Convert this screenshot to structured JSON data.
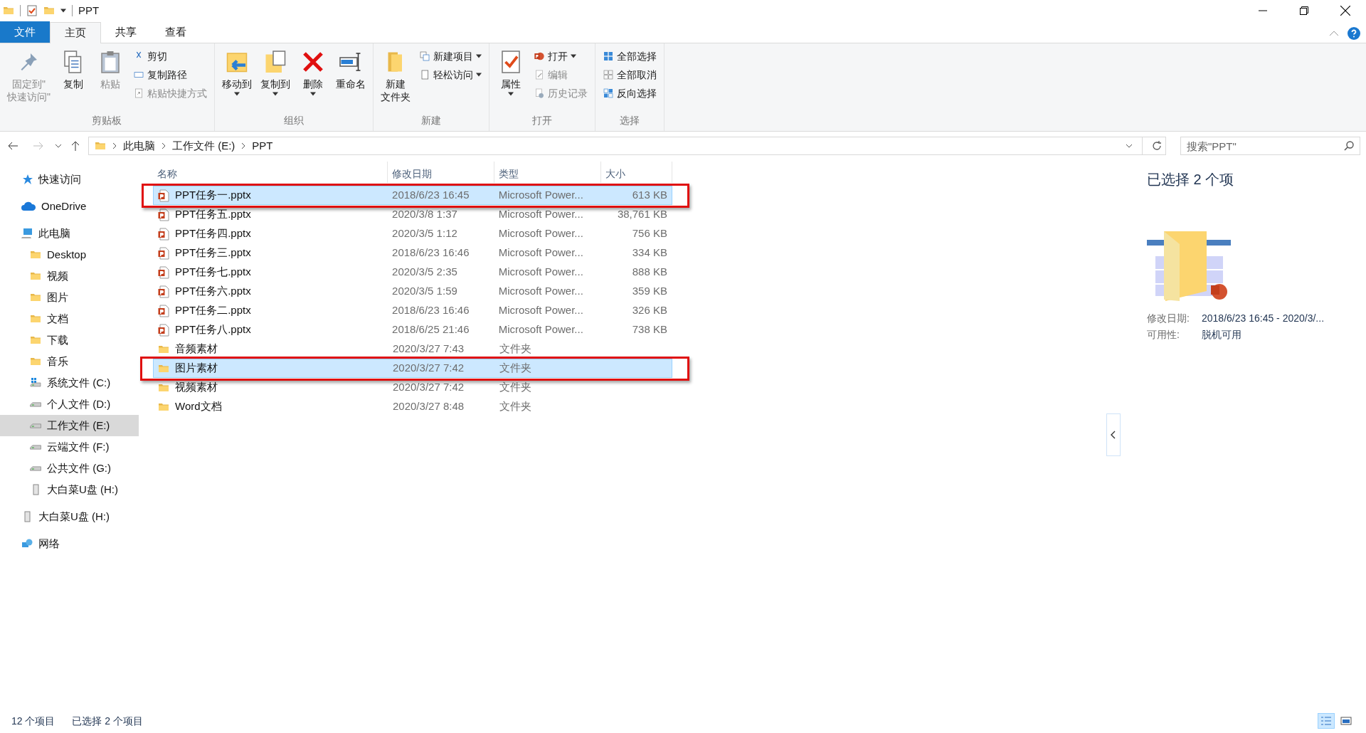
{
  "window": {
    "title": "PPT"
  },
  "file_menu": {
    "label": "文件"
  },
  "menu_tabs": [
    {
      "label": "主页",
      "selected": true
    },
    {
      "label": "共享",
      "selected": false
    },
    {
      "label": "查看",
      "selected": false
    }
  ],
  "ribbon": [
    {
      "label": "剪贴板",
      "items": [
        {
          "kind": "large",
          "lines": [
            "固定到\"",
            "快速访问\""
          ],
          "disabled": true
        },
        {
          "kind": "large",
          "lines": [
            "复制"
          ],
          "disabled": false
        },
        {
          "kind": "large",
          "lines": [
            "粘贴"
          ],
          "disabled": true
        },
        {
          "kind": "stack",
          "items": [
            {
              "label": "剪切",
              "disabled": false
            },
            {
              "label": "复制路径",
              "disabled": false
            },
            {
              "label": "粘贴快捷方式",
              "disabled": true
            }
          ]
        }
      ]
    },
    {
      "label": "组织",
      "items": [
        {
          "kind": "large",
          "lines": [
            "移动到"
          ],
          "dropdown": true,
          "disabled": false
        },
        {
          "kind": "large",
          "lines": [
            "复制到"
          ],
          "dropdown": true,
          "disabled": false
        },
        {
          "kind": "large",
          "lines": [
            "删除"
          ],
          "dropdown": true,
          "disabled": false
        },
        {
          "kind": "large",
          "lines": [
            "重命名"
          ],
          "disabled": false
        }
      ]
    },
    {
      "label": "新建",
      "items": [
        {
          "kind": "large",
          "lines": [
            "新建",
            "文件夹"
          ],
          "disabled": false
        },
        {
          "kind": "stack",
          "items": [
            {
              "label": "新建项目",
              "dropdown": true,
              "disabled": false
            },
            {
              "label": "轻松访问",
              "dropdown": true,
              "disabled": false
            }
          ]
        }
      ]
    },
    {
      "label": "打开",
      "items": [
        {
          "kind": "large",
          "lines": [
            "属性"
          ],
          "dropdown": true,
          "disabled": false
        },
        {
          "kind": "stack",
          "items": [
            {
              "label": "打开",
              "dropdown": true,
              "disabled": false
            },
            {
              "label": "编辑",
              "disabled": true
            },
            {
              "label": "历史记录",
              "disabled": true
            }
          ]
        }
      ]
    },
    {
      "label": "选择",
      "items": [
        {
          "kind": "stack",
          "items": [
            {
              "label": "全部选择",
              "disabled": false
            },
            {
              "label": "全部取消",
              "disabled": false
            },
            {
              "label": "反向选择",
              "disabled": false
            }
          ]
        }
      ]
    }
  ],
  "address_bar": {
    "path": [
      "此电脑",
      "工作文件 (E:)",
      "PPT"
    ]
  },
  "search": {
    "placeholder": "搜索\"PPT\""
  },
  "sidebar": [
    {
      "label": "快速访问",
      "kind": "star",
      "selected": false
    },
    {
      "label": "OneDrive",
      "kind": "cloud",
      "selected": false
    },
    {
      "label": "此电脑",
      "kind": "pc",
      "selected": false,
      "children": [
        {
          "label": "Desktop",
          "kind": "folder",
          "selected": false
        },
        {
          "label": "视频",
          "kind": "folder",
          "selected": false
        },
        {
          "label": "图片",
          "kind": "folder",
          "selected": false
        },
        {
          "label": "文档",
          "kind": "folder",
          "selected": false
        },
        {
          "label": "下载",
          "kind": "folder",
          "selected": false
        },
        {
          "label": "音乐",
          "kind": "folder",
          "selected": false
        },
        {
          "label": "系统文件 (C:)",
          "kind": "sysdrive",
          "selected": false
        },
        {
          "label": "个人文件 (D:)",
          "kind": "drive",
          "selected": false
        },
        {
          "label": "工作文件 (E:)",
          "kind": "drive",
          "selected": true
        },
        {
          "label": "云端文件 (F:)",
          "kind": "drive",
          "selected": false
        },
        {
          "label": "公共文件 (G:)",
          "kind": "drive",
          "selected": false
        },
        {
          "label": "大白菜U盘 (H:)",
          "kind": "usb",
          "selected": false
        }
      ]
    },
    {
      "label": "大白菜U盘 (H:)",
      "kind": "usb",
      "selected": false
    },
    {
      "label": "网络",
      "kind": "network",
      "selected": false
    }
  ],
  "file_list": {
    "columns": [
      "名称",
      "修改日期",
      "类型",
      "大小"
    ],
    "rows": [
      {
        "name": "PPT任务一.pptx",
        "date": "2018/6/23 16:45",
        "type": "Microsoft Power...",
        "size": "613 KB",
        "kind": "pptx",
        "selected": true
      },
      {
        "name": "PPT任务五.pptx",
        "date": "2020/3/8 1:37",
        "type": "Microsoft Power...",
        "size": "38,761 KB",
        "kind": "pptx",
        "selected": false
      },
      {
        "name": "PPT任务四.pptx",
        "date": "2020/3/5 1:12",
        "type": "Microsoft Power...",
        "size": "756 KB",
        "kind": "pptx",
        "selected": false
      },
      {
        "name": "PPT任务三.pptx",
        "date": "2018/6/23 16:46",
        "type": "Microsoft Power...",
        "size": "334 KB",
        "kind": "pptx",
        "selected": false
      },
      {
        "name": "PPT任务七.pptx",
        "date": "2020/3/5 2:35",
        "type": "Microsoft Power...",
        "size": "888 KB",
        "kind": "pptx",
        "selected": false
      },
      {
        "name": "PPT任务六.pptx",
        "date": "2020/3/5 1:59",
        "type": "Microsoft Power...",
        "size": "359 KB",
        "kind": "pptx",
        "selected": false
      },
      {
        "name": "PPT任务二.pptx",
        "date": "2018/6/23 16:46",
        "type": "Microsoft Power...",
        "size": "326 KB",
        "kind": "pptx",
        "selected": false
      },
      {
        "name": "PPT任务八.pptx",
        "date": "2018/6/25 21:46",
        "type": "Microsoft Power...",
        "size": "738 KB",
        "kind": "pptx",
        "selected": false
      },
      {
        "name": "音频素材",
        "date": "2020/3/27 7:43",
        "type": "文件夹",
        "kind": "folder",
        "selected": false
      },
      {
        "name": "图片素材",
        "date": "2020/3/27 7:42",
        "type": "文件夹",
        "kind": "folder",
        "selected": true
      },
      {
        "name": "视频素材",
        "date": "2020/3/27 7:42",
        "type": "文件夹",
        "kind": "folder",
        "selected": false
      },
      {
        "name": "Word文档",
        "date": "2020/3/27 8:48",
        "type": "文件夹",
        "kind": "folder",
        "selected": false
      }
    ]
  },
  "details_pane": {
    "title": "已选择 2 个项",
    "properties": [
      {
        "label": "修改日期:",
        "value": "2018/6/23 16:45 - 2020/3/..."
      },
      {
        "label": "可用性:",
        "value": "脱机可用"
      }
    ]
  },
  "status_bar": {
    "count": "12 个项目",
    "selection": "已选择 2 个项目"
  }
}
